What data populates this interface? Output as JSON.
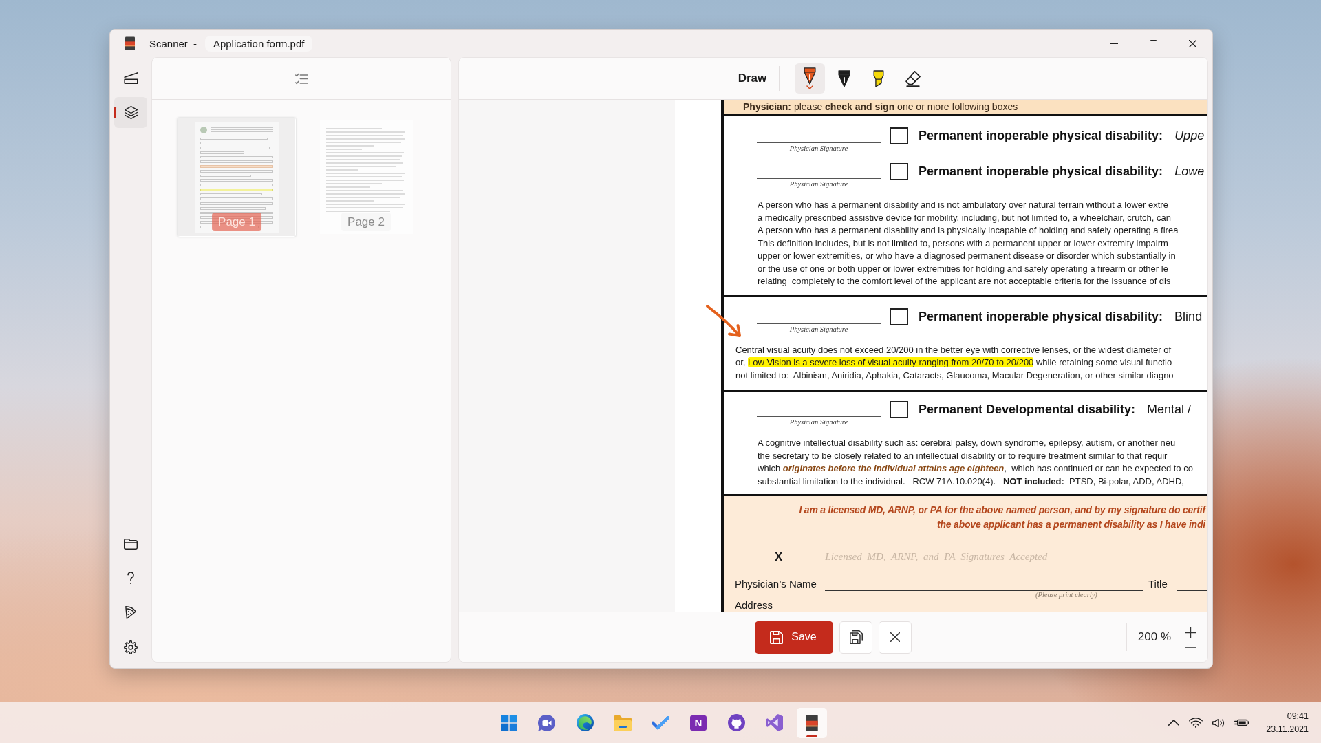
{
  "window": {
    "app_name": "Scanner",
    "separator": "-",
    "file_name": "Application form.pdf"
  },
  "nav": {
    "top": [
      {
        "kind": "scan",
        "selected": false
      },
      {
        "kind": "pages",
        "selected": true
      }
    ],
    "bottom": [
      {
        "kind": "folder",
        "selected": false
      },
      {
        "kind": "help",
        "selected": false
      },
      {
        "kind": "pizza",
        "selected": false
      },
      {
        "kind": "settings",
        "selected": false
      }
    ]
  },
  "pages_panel": {
    "pages": [
      {
        "label": "Page 1",
        "selected": true
      },
      {
        "label": "Page 2",
        "selected": false
      }
    ]
  },
  "editor": {
    "toolbar": {
      "title": "Draw",
      "tools": [
        {
          "kind": "pen",
          "color": "#e2571e",
          "selected": true
        },
        {
          "kind": "pen",
          "color": "#1c1c1c",
          "selected": false
        },
        {
          "kind": "highlighter",
          "color": "#f5d90a",
          "selected": false
        },
        {
          "kind": "eraser",
          "selected": false
        }
      ]
    },
    "document": {
      "banner": "**Physician:** please **check and sign** one or more following boxes",
      "sections": [
        {
          "rows": [
            {
              "signature_label": "Physician Signature",
              "checked": false,
              "heading": "**Permanent inoperable physical disability:** *Uppe*"
            },
            {
              "signature_label": "Physician Signature",
              "checked": false,
              "heading": "**Permanent inoperable physical disability:** *Lowe*"
            }
          ],
          "paragraph": [
            "A person who has a permanent disability and is not ambulatory over natural terrain without a lower extre",
            "a medically prescribed assistive device for mobility, including, but not limited to, a wheelchair, crutch, can",
            "A person who has a permanent disability and is physically incapable of holding and safely operating a firea",
            "This definition includes, but is not limited to, persons with a permanent upper or lower extremity impairm",
            "upper or lower extremities, or who have a diagnosed permanent disease or disorder which substantially in",
            "or the use of one or both upper or lower extremities for holding and safely operating a firearm or other le",
            "relating  completely to the comfort level of the applicant are not acceptable criteria for the issuance of dis"
          ]
        },
        {
          "rows": [
            {
              "signature_label": "Physician Signature",
              "checked": false,
              "heading": "**Permanent inoperable physical disability:** Blind"
            }
          ],
          "annotations": [
            {
              "kind": "arrow"
            }
          ],
          "paragraph": [
            "Central visual acuity does not exceed 20/200 in the better eye with corrective lenses, or the widest diameter of",
            [
              {
                "text": "or, ",
                "highlighted": false
              },
              {
                "text": "Low Vision is a severe loss of visual acuity ranging from 20/70 to 20/200",
                "highlighted": true
              },
              {
                "text": " while retaining some visual functio",
                "highlighted": false
              }
            ],
            "not limited to:  Albinism, Aniridia, Aphakia, Cataracts, Glaucoma, Macular Degeneration, or other similar diagno"
          ]
        },
        {
          "rows": [
            {
              "signature_label": "Physician Signature",
              "checked": false,
              "heading": "**Permanent Developmental disability:** Mental /"
            }
          ],
          "paragraph": [
            "A cognitive intellectual disability such as: cerebral palsy, down syndrome, epilepsy, autism, or another neu",
            "the secretary to be closely related to an intellectual disability or to require treatment similar to that requir",
            "which *originates before the individual attains age eighteen*,  which has continued or can be expected to co",
            "substantial limitation to the individual.   RCW 71A.10.020(4).   **NOT included:**  PTSD, Bi-polar, ADD, ADHD,"
          ]
        }
      ],
      "certification": {
        "statement": [
          "I am a licensed MD, ARNP, or PA for the above named person, and by my signature do certif",
          "the above applicant has a permanent disability as I have indi"
        ],
        "sign_mark": "X",
        "signature_placeholder": "Licensed MD, ARNP, and PA Signatures Accepted",
        "name_label": "Physician’s Name",
        "name_hint": "(Please print clearly)",
        "title_label": "Title",
        "address_label": "Address"
      }
    },
    "footer": {
      "save_label": "Save",
      "zoom": "200 %"
    }
  },
  "taskbar": {
    "apps": [
      {
        "kind": "start",
        "selected": false
      },
      {
        "kind": "chat",
        "selected": false
      },
      {
        "kind": "browser",
        "selected": false
      },
      {
        "kind": "files",
        "selected": false
      },
      {
        "kind": "todo",
        "selected": false
      },
      {
        "kind": "notes",
        "letter": "N",
        "selected": false
      },
      {
        "kind": "github",
        "selected": false
      },
      {
        "kind": "ide",
        "selected": false
      },
      {
        "kind": "scanner",
        "selected": true
      }
    ],
    "time": "09:41",
    "date": "23.11.2021"
  }
}
